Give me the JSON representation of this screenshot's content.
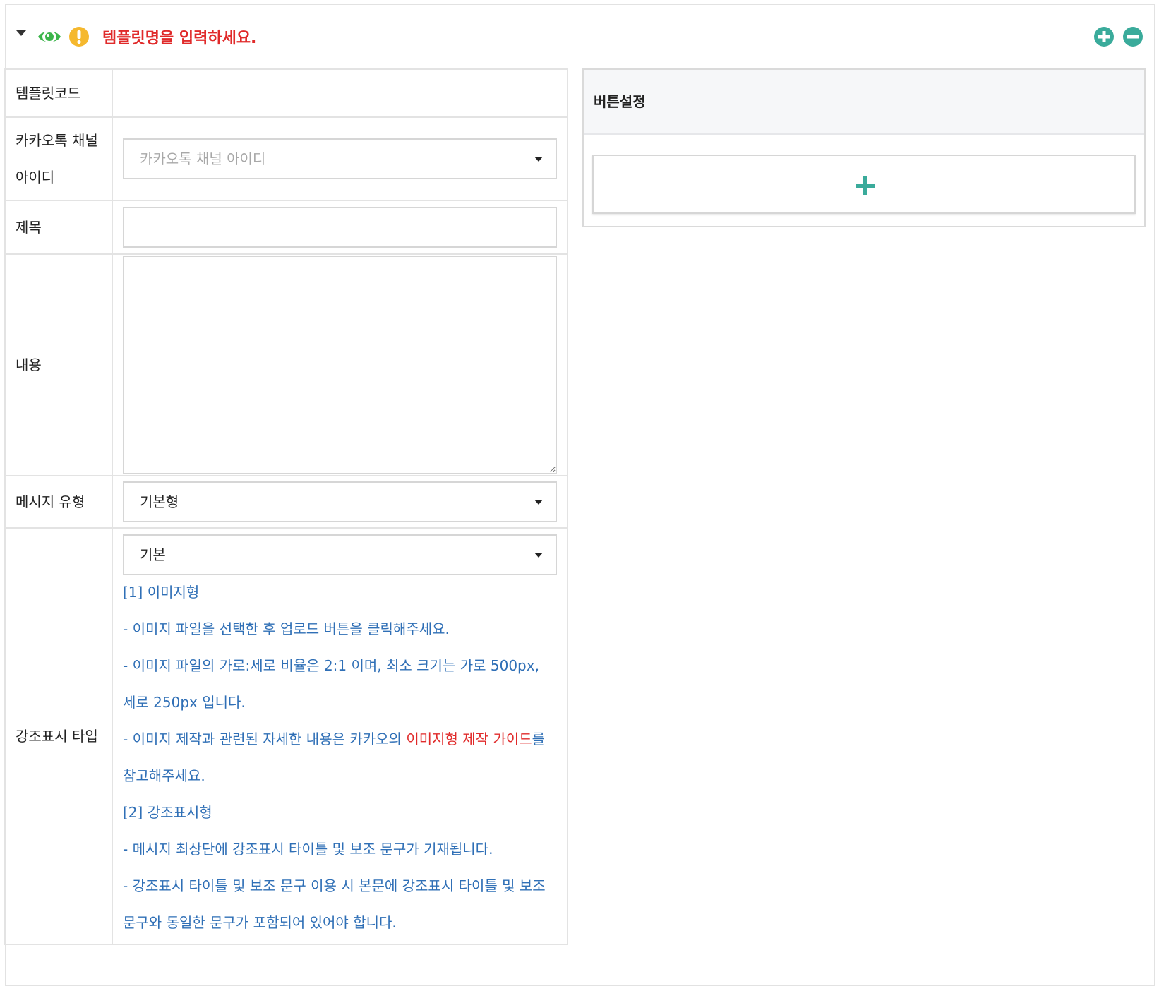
{
  "header": {
    "title": "템플릿명을 입력하세요.",
    "icons": {
      "collapse": "caret-down-icon",
      "visibility": "eye-icon",
      "warning": "exclamation-circle-icon",
      "add": "plus-circle-icon",
      "remove": "minus-circle-icon"
    }
  },
  "colors": {
    "title_red": "#e02a2a",
    "eye_green": "#3bb54a",
    "warning_yellow": "#f5b82e",
    "action_teal": "#3aab9b",
    "guide_blue": "#2f6fb6"
  },
  "form": {
    "template_code": {
      "label": "템플릿코드",
      "value": ""
    },
    "channel_id": {
      "label_line1": "카카오톡 채널",
      "label_line2": "아이디",
      "placeholder": "카카오톡 채널 아이디"
    },
    "subject": {
      "label": "제목",
      "value": ""
    },
    "content": {
      "label": "내용",
      "value": ""
    },
    "message_type": {
      "label": "메시지 유형",
      "value": "기본형"
    },
    "emphasis_type": {
      "label": "강조표시 타입",
      "value": "기본",
      "guide": {
        "line1": "[1] 이미지형",
        "line2": "- 이미지 파일을 선택한 후 업로드 버튼을 클릭해주세요.",
        "line3": "- 이미지 파일의 가로:세로 비율은 2:1 이며, 최소 크기는 가로 500px,",
        "line4": "세로 250px 입니다.",
        "line5_pre": "- 이미지 제작과 관련된 자세한 내용은 카카오의 ",
        "line5_link": "이미지형 제작 가이드",
        "line5_post": "를",
        "line6": "참고해주세요.",
        "line7": "[2] 강조표시형",
        "line8": "- 메시지 최상단에 강조표시 타이틀 및 보조 문구가 기재됩니다.",
        "line9": "- 강조표시 타이틀 및 보조 문구 이용 시 본문에 강조표시 타이틀 및 보조",
        "line10": "문구와 동일한 문구가 포함되어 있어야 합니다."
      }
    }
  },
  "button_settings": {
    "title": "버튼설정",
    "add_icon": "plus-icon"
  }
}
